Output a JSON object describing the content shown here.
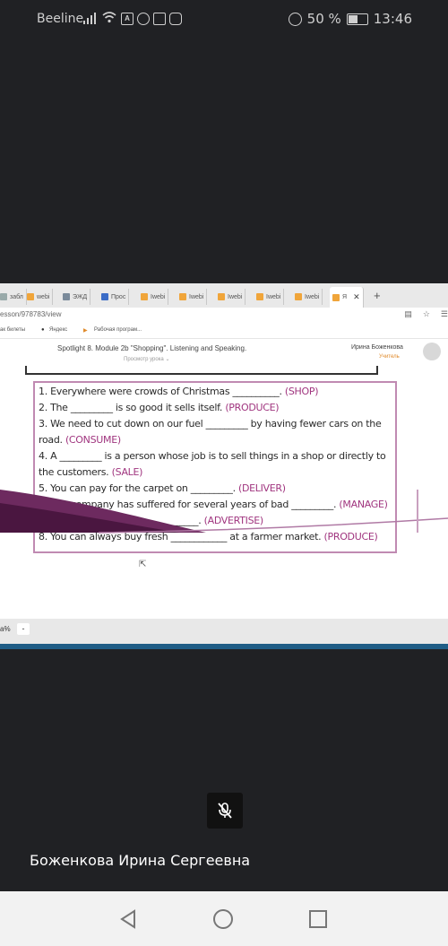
{
  "status_bar": {
    "carrier": "Beeline",
    "battery": "50 %",
    "time": "13:46"
  },
  "browser": {
    "tabs": [
      "забл",
      "webi",
      "ЭЖД",
      "Прос",
      "Iwebi",
      "Iwebi",
      "Iwebi",
      "Iwebi",
      "Iwebi",
      "Я"
    ],
    "url": "esson/978783/view",
    "bookmarks": [
      "ак билеты",
      "Яндекс",
      "Рабочая програм..."
    ]
  },
  "lesson": {
    "title": "Spotlight 8. Module 2b \"Shopping\". Listening and Speaking.",
    "subtitle": "Просмотр урока",
    "user_name": "Ирина Боженкова",
    "user_role": "Учитель"
  },
  "exercise": {
    "items": [
      {
        "text": "1. Everywhere were crowds of Christmas __________. ",
        "hint": "(SHOP)"
      },
      {
        "text": "2. The _________ is so good it sells itself. ",
        "hint": "(PRODUCE)"
      },
      {
        "text": "3. We need to cut down on our fuel _________ by having fewer cars on the",
        "hint": ""
      },
      {
        "text": "road. ",
        "hint": "(CONSUME)"
      },
      {
        "text": "4. A _________ is a person whose job is to sell things in a shop or directly to",
        "hint": ""
      },
      {
        "text": "the customers. ",
        "hint": "(SALE)"
      },
      {
        "text": "5. You can pay for the carpet on _________. ",
        "hint": "(DELIVER)"
      },
      {
        "text": "6. The company has suffered for several years of bad _________. ",
        "hint": "(MANAGE)"
      },
      {
        "text": "7. It's a very effective ____________. ",
        "hint": "(ADVERTISE)"
      },
      {
        "text": "8. You can always buy fresh ____________ at a farmer market. ",
        "hint": "(PRODUCE)"
      }
    ]
  },
  "zoom": {
    "level": "а%",
    "button": "-"
  },
  "participant": {
    "name": "Боженкова Ирина Сергеевна"
  },
  "icons": {
    "mute": "microphone-muted-icon",
    "back": "back-triangle-icon",
    "home": "home-circle-icon",
    "recents": "recents-square-icon"
  }
}
